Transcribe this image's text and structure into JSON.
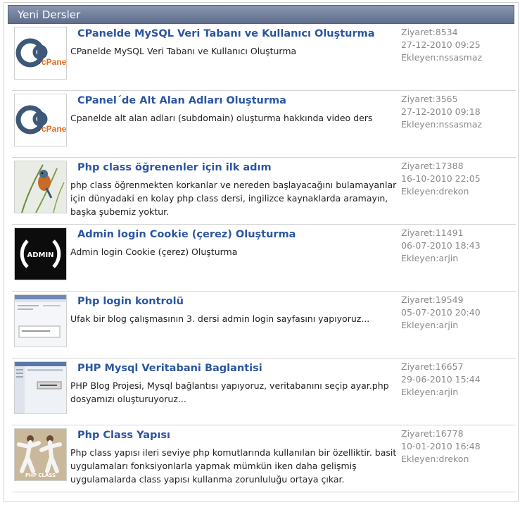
{
  "header": {
    "title": "Yeni Dersler"
  },
  "items": [
    {
      "title": "CPanelde MySQL Veri Tabanı ve Kullanıcı Oluşturma",
      "desc": "CPanelde MySQL Veri Tabanı ve Kullanıcı Oluşturma",
      "views": "Ziyaret:8534",
      "date": "27-12-2010 09:25",
      "author": "Ekleyen:nssasmaz",
      "thumb": "cpanel-logo",
      "thumb_text": "cPanel"
    },
    {
      "title": "CPanel´de Alt Alan Adları Oluşturma",
      "desc": "Cpanelde alt alan adları (subdomain) oluşturma hakkında video ders",
      "views": "Ziyaret:3565",
      "date": "27-12-2010 09:18",
      "author": "Ekleyen:nssasmaz",
      "thumb": "cpanel-logo",
      "thumb_text": "cPanel"
    },
    {
      "title": "Php class öğrenenler için ilk adım",
      "desc": "php class öğrenmekten korkanlar ve nereden başlayacağını bulamayanlar için dünyadaki en kolay php class dersi, ingilizce kaynaklarda aramayın, başka şubemiz yoktur.",
      "views": "Ziyaret:17388",
      "date": "16-10-2010 22:05",
      "author": "Ekleyen:drekon",
      "thumb": "bird-image"
    },
    {
      "title": "Admin login Cookie (çerez) Oluşturma",
      "desc": "Admin login Cookie (çerez) Oluşturma",
      "views": "Ziyaret:11491",
      "date": "06-07-2010 18:43",
      "author": "Ekleyen:arjin",
      "thumb": "admin-logo",
      "thumb_text": "ADMIN"
    },
    {
      "title": "Php login kontrolü",
      "desc": "Ufak bir blog çalışmasının 3. dersi admin login sayfasını yapıyoruz...",
      "views": "Ziyaret:19549",
      "date": "05-07-2010 20:40",
      "author": "Ekleyen:arjin",
      "thumb": "screenshot-thumb"
    },
    {
      "title": "PHP Mysql Veritabani Baglantisi",
      "desc": "PHP Blog Projesi, Mysql bağlantısı yapıyoruz, veritabanını seçip ayar.php dosyamızı oluşturuyoruz...",
      "views": "Ziyaret:16657",
      "date": "29-06-2010 15:44",
      "author": "Ekleyen:arjin",
      "thumb": "screenshot-thumb"
    },
    {
      "title": "Php Class Yapısı",
      "desc": "Php class yapısı ileri seviye php komutlarında kullanılan bir özelliktir. basit uygulamaları fonksiyonlarla yapmak mümkün iken daha gelişmiş uygulamalarda class yapısı kullanma zorunluluğu ortaya çıkar.",
      "views": "Ziyaret:16778",
      "date": "10-01-2010 16:48",
      "author": "Ekleyen:drekon",
      "thumb": "karate-image",
      "thumb_text": "PHP CLASS"
    }
  ]
}
